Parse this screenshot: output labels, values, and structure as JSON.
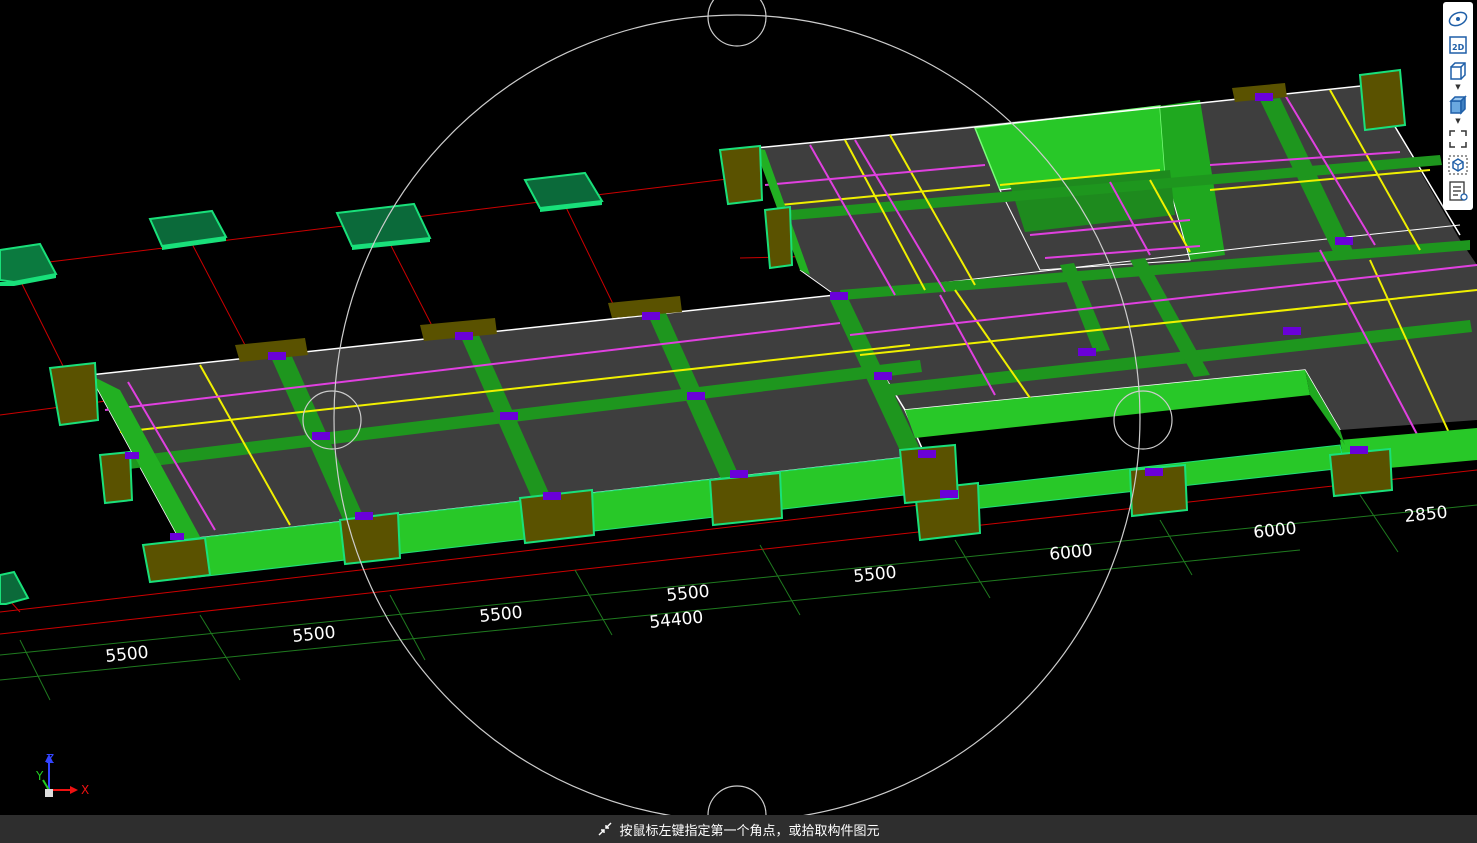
{
  "viewport": {
    "dimensions_front": [
      "5500",
      "5500",
      "5500",
      "5500",
      "5500",
      "6000",
      "6000",
      "2850"
    ],
    "dimension_total": "54400"
  },
  "axis": {
    "x": "X",
    "y": "Y",
    "z": "Z"
  },
  "toolbar": {
    "items": [
      "orbit",
      "2d-view",
      "3d-view",
      "shaded-3d-view",
      "fit-view",
      "local-3d",
      "properties-view"
    ],
    "label_2d": "2D"
  },
  "status": {
    "prompt": "按鼠标左键指定第一个角点，或拾取构件图元"
  },
  "colors": {
    "background": "#000000",
    "beam": "#28c828",
    "slab": "#3e3e3e",
    "pile_cap": "#5a5200",
    "rebar_x": "#f0f000",
    "rebar_y": "#e040e0",
    "axis_line": "#cc0000",
    "dim_line": "#1f7a1f",
    "column": "#6a00d8",
    "status_bar": "#2e2e2e"
  }
}
